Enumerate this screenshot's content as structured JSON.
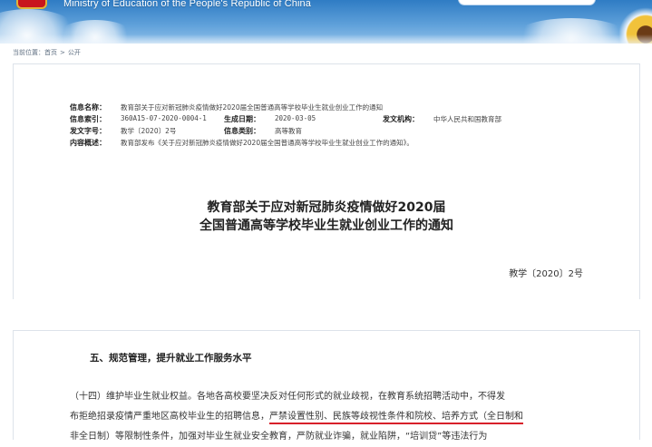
{
  "header": {
    "ministry_name": "Ministry of Education of the People's Republic of China"
  },
  "breadcrumb": {
    "prefix": "当前位置：",
    "items": [
      "首页",
      "公开"
    ],
    "separator": ">"
  },
  "meta": {
    "rows": [
      {
        "label": "信息名称：",
        "value": "教育部关于应对新冠肺炎疫情做好2020届全国普通高等学校毕业生就业创业工作的通知"
      },
      {
        "label": "信息索引：",
        "value": "360A15-07-2020-0004-1",
        "label2": "生成日期：",
        "value2": "2020-03-05",
        "label3": "发文机构：",
        "value3": "中华人民共和国教育部"
      },
      {
        "label": "发文字号：",
        "value": "教学〔2020〕2号",
        "label2": "信息类别：",
        "value2": "高等教育"
      },
      {
        "label": "内容概述：",
        "value": "教育部发布《关于应对新冠肺炎疫情做好2020届全国普通高等学校毕业生就业创业工作的通知》。"
      }
    ]
  },
  "document": {
    "title_line1": "教育部关于应对新冠肺炎疫情做好2020届",
    "title_line2": "全国普通高等学校毕业生就业创业工作的通知",
    "number": "教学〔2020〕2号"
  },
  "section": {
    "heading": "五、规范管理，提升就业工作服务水平",
    "para_line1": "（十四）维护毕业生就业权益。各地各高校要坚决反对任何形式的就业歧视，在教育系统招聘活动中，不得发",
    "para_line2_plain": "布拒绝招录疫情严重地区高校毕业生的招聘信息，",
    "para_line2_highlight": "严禁设置性别、民族等歧视性条件和院校、培养方式（全日制和",
    "para_line3": "非全日制）等限制性条件，加强对毕业生就业安全教育，严防就业诈骗，就业陷阱，“培训贷”等违法行为"
  },
  "colors": {
    "header_blue": "#2f7cc4",
    "highlight_red": "#d8202a"
  }
}
